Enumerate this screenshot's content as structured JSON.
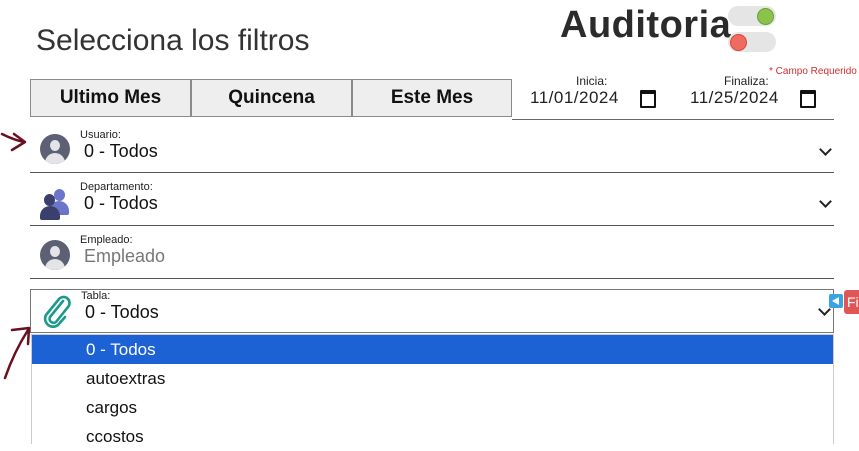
{
  "header": {
    "title": "Selecciona los filtros",
    "app_title": "Auditoria",
    "required_note": "* Campo Requerido"
  },
  "range_buttons": {
    "ultimo_mes": "Ultimo Mes",
    "quincena": "Quincena",
    "este_mes": "Este Mes"
  },
  "dates": {
    "start_label": "Inicia:",
    "start_value": "11/01/2024",
    "end_label": "Finaliza:",
    "end_value": "11/25/2024"
  },
  "filters": {
    "usuario": {
      "label": "Usuario:",
      "value": "0 - Todos"
    },
    "departamento": {
      "label": "Departamento:",
      "value": "0 - Todos"
    },
    "empleado": {
      "label": "Empleado:",
      "placeholder": "Empleado"
    },
    "tabla": {
      "label": "Tabla:",
      "value": "0 - Todos"
    }
  },
  "dropdown_options": [
    "0 - Todos",
    "autoextras",
    "cargos",
    "ccostos"
  ],
  "side_tab": {
    "label": "Fi"
  },
  "colors": {
    "accent": "#1c62d4",
    "toggle_on": "#8bc34a",
    "toggle_off": "#ef6b60",
    "annotation_arrow": "#6b1020",
    "paperclip": "#1a9a8a",
    "required": "#d03030"
  }
}
